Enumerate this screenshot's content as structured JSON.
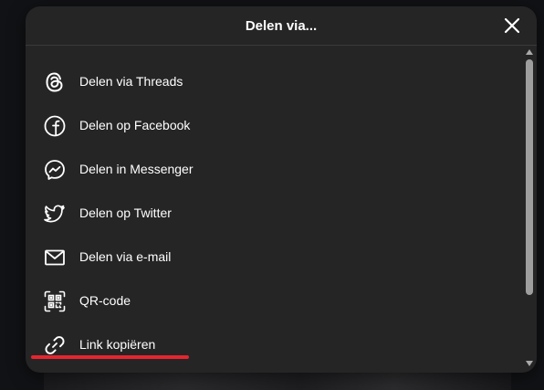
{
  "dialog": {
    "title": "Delen via...",
    "close_icon": "close-icon"
  },
  "options": [
    {
      "label": "Delen via Threads",
      "icon": "threads-icon"
    },
    {
      "label": "Delen op Facebook",
      "icon": "facebook-icon"
    },
    {
      "label": "Delen in Messenger",
      "icon": "messenger-icon"
    },
    {
      "label": "Delen op Twitter",
      "icon": "twitter-icon"
    },
    {
      "label": "Delen via e-mail",
      "icon": "email-icon"
    },
    {
      "label": "QR-code",
      "icon": "qr-code-icon"
    },
    {
      "label": "Link kopiëren",
      "icon": "link-icon"
    }
  ],
  "colors": {
    "dialog_background": "#252526",
    "text": "#ffffff",
    "highlight_underline": "#e5252e",
    "scrollbar_thumb": "#9e9e9e"
  }
}
